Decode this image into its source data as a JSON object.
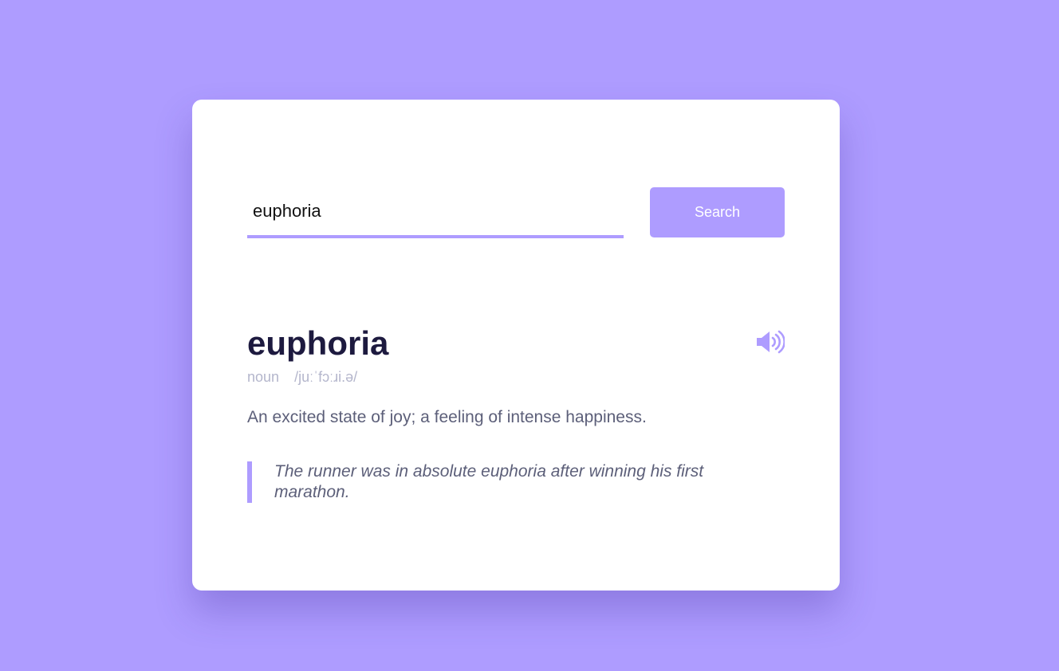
{
  "colors": {
    "background": "#ae9cff",
    "accent": "#ae9cff",
    "card": "#ffffff",
    "word_text": "#1d1a3f",
    "body_text": "#5c5f79",
    "muted_text": "#b4b6cc"
  },
  "search": {
    "value": "euphoria",
    "button_label": "Search"
  },
  "result": {
    "word": "euphoria",
    "part_of_speech": "noun",
    "phonetic": "/juːˈfɔːɹi.ə/",
    "definition": "An excited state of joy; a feeling of intense happiness.",
    "example": "The runner was in absolute euphoria after winning his first marathon.",
    "audio_icon": "speaker-volume-icon"
  }
}
